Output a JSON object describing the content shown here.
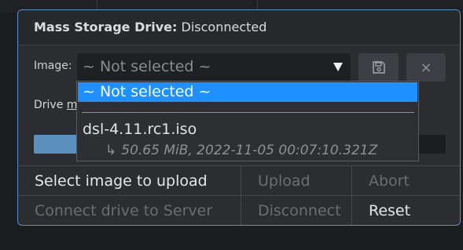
{
  "header": {
    "title_bold": "Mass Storage Drive:",
    "title_status": "Disconnected"
  },
  "image_select": {
    "label": "Image:",
    "value": "~ Not selected ~",
    "arrow": "▼"
  },
  "buttons": {
    "save_icon": "floppy-disk-icon",
    "close_label": "×"
  },
  "drive": {
    "label_prefix": "Drive",
    "label_link": "mo"
  },
  "progress": {
    "fill_fraction": 0.34
  },
  "actions": {
    "select_image": "Select image to upload",
    "upload": "Upload",
    "abort": "Abort",
    "connect": "Connect drive to Server",
    "disconnect": "Disconnect",
    "reset": "Reset"
  },
  "dropdown": {
    "options": [
      {
        "label": "~ Not selected ~",
        "selected": true
      },
      {
        "label": "dsl-4.11.rc1.iso",
        "arrow": "↳",
        "detail": "50.65 MiB, 2022-11-05 00:07:10.321Z"
      }
    ]
  },
  "colors": {
    "accent": "#1e90ff",
    "panel_border": "#5a8fc4",
    "progress": "#5b8fbe"
  }
}
